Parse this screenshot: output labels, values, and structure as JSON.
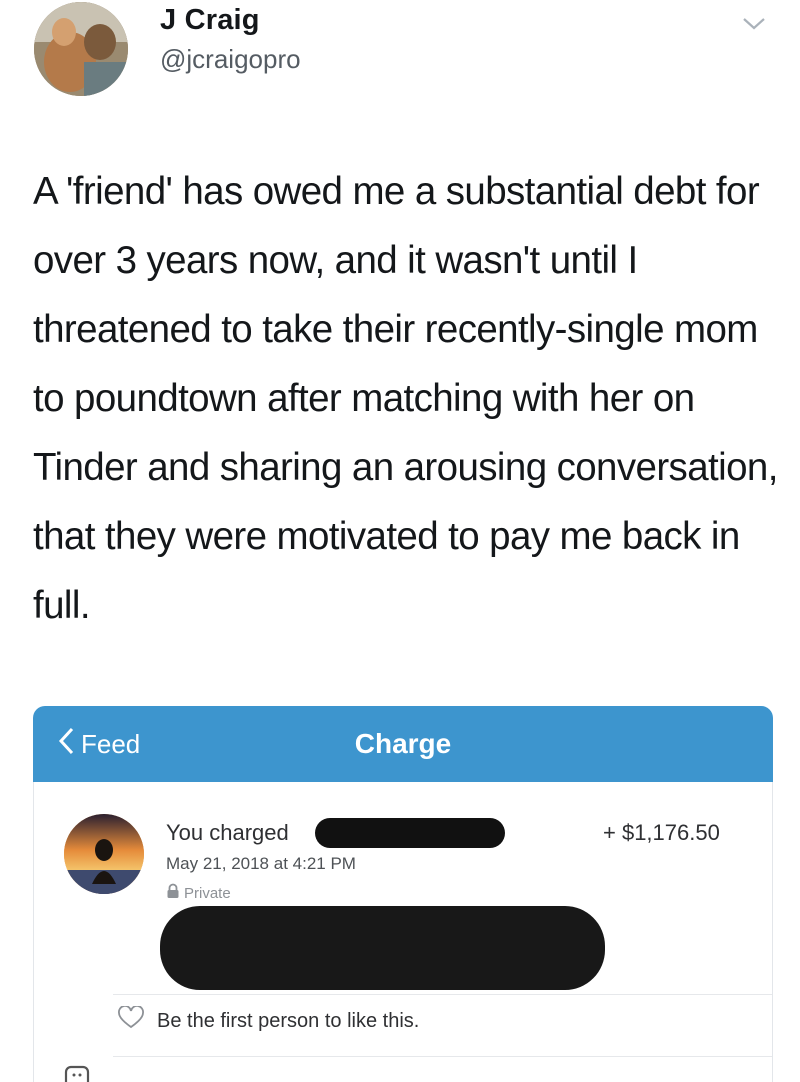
{
  "tweet": {
    "display_name": "J Craig",
    "handle": "@jcraigopro",
    "text": "A 'friend' has owed me a substantial debt for over 3 years now, and it wasn't until I threatened to take their recently-single mom to poundtown after matching with her on Tinder and sharing an arousing conversation, that they were motivated to pay me back in full."
  },
  "embedded": {
    "nav": {
      "back_label": "Feed",
      "title": "Charge"
    },
    "transaction": {
      "title": "You charged",
      "amount": "+ $1,176.50",
      "date": "May 21, 2018 at 4:21 PM",
      "privacy": "Private"
    },
    "like_text": "Be the first person to like this."
  },
  "colors": {
    "nav_blue": "#3d95ce",
    "text": "#14171a",
    "redaction": "#111111"
  },
  "icons": [
    "chevron-down-icon",
    "chevron-left-icon",
    "lock-icon",
    "heart-icon",
    "comment-icon"
  ]
}
